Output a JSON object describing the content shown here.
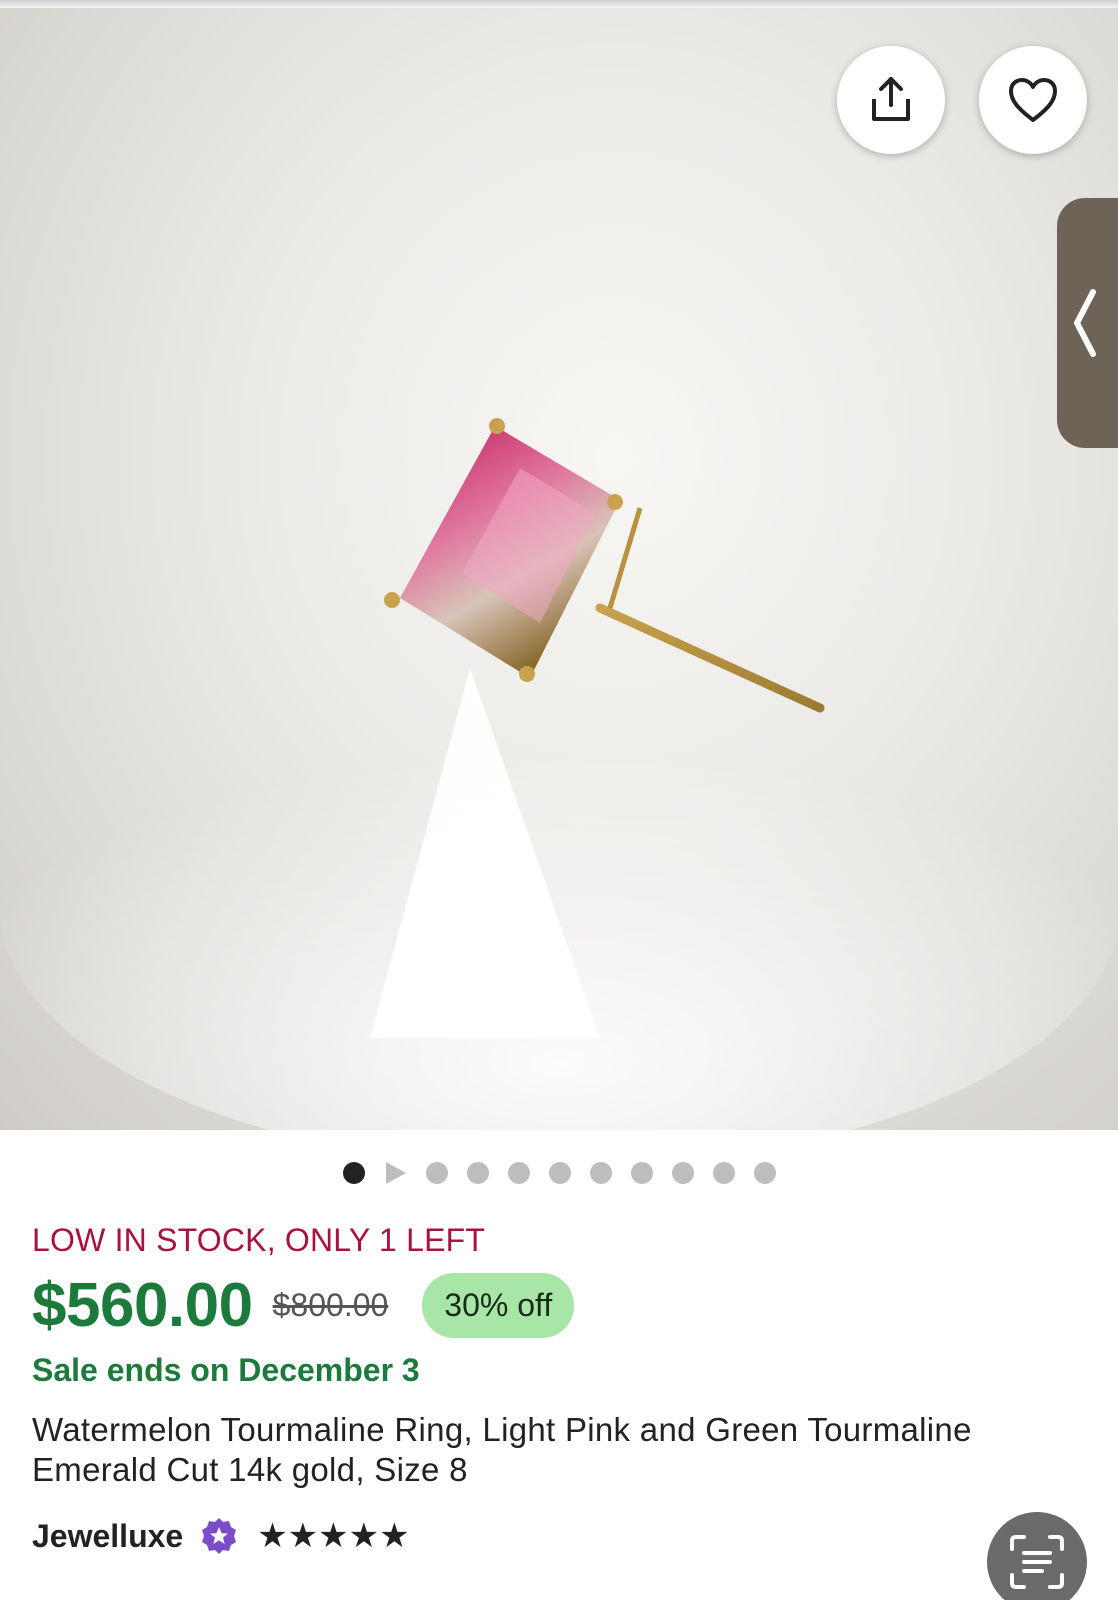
{
  "hero": {
    "alt_icon": "product-photo-ring"
  },
  "carousel": {
    "total_dots": 11,
    "active_index": 0,
    "video_index": 1
  },
  "product": {
    "stock_notice": "LOW IN STOCK, ONLY 1 LEFT",
    "price": "$560.00",
    "original_price": "$800.00",
    "discount_badge": "30% off",
    "sale_ends": "Sale ends on December 3",
    "title_line1": "Watermelon Tourmaline Ring, Light Pink and Green Tourmaline",
    "title_line2": "Emerald Cut 14k gold, Size 8"
  },
  "seller": {
    "name": "Jewelluxe",
    "rating": 5,
    "stars_text": "★★★★★"
  },
  "colors": {
    "price_green": "#1b7a3c",
    "stock_red": "#a8123e",
    "badge_green": "#a8e6a8",
    "star_seller_purple": "#7b4cc9"
  },
  "icons": {
    "share": "share-icon",
    "favorite": "heart-icon",
    "side_tab": "chevron-left-icon",
    "scan": "scan-text-icon"
  }
}
